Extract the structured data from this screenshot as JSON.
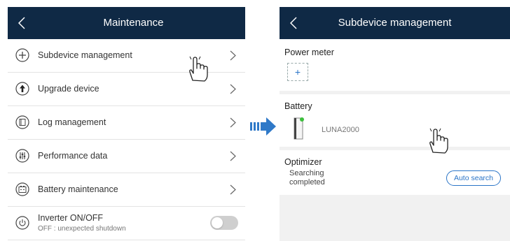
{
  "left_screen": {
    "title": "Maintenance",
    "items": [
      {
        "icon": "plus-circle-icon",
        "label": "Subdevice management"
      },
      {
        "icon": "upload-circle-icon",
        "label": "Upgrade device"
      },
      {
        "icon": "log-icon",
        "label": "Log management"
      },
      {
        "icon": "sliders-icon",
        "label": "Performance data"
      },
      {
        "icon": "battery-icon",
        "label": "Battery maintenance"
      },
      {
        "icon": "power-icon",
        "label": "Inverter ON/OFF",
        "sublabel": "OFF : unexpected shutdown",
        "toggle_on": false
      }
    ]
  },
  "right_screen": {
    "title": "Subdevice management",
    "power_meter": {
      "title": "Power meter",
      "add_symbol": "+"
    },
    "battery": {
      "title": "Battery",
      "device": "LUNA2000"
    },
    "optimizer": {
      "title": "Optimizer",
      "status_line1": "Searching",
      "status_line2": "completed",
      "button": "Auto search"
    }
  },
  "colors": {
    "header": "#0f2945",
    "accent": "#2a74c7",
    "arrow": "#2f79c8",
    "battery_dot": "#3cbf3c"
  }
}
